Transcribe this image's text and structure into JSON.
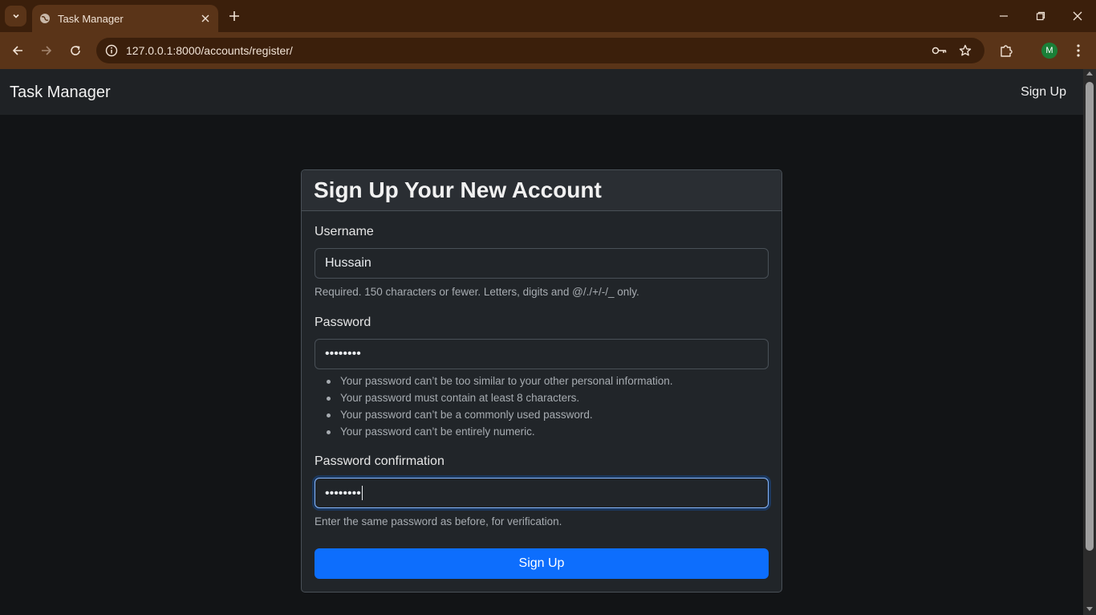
{
  "browser": {
    "tab_title": "Task Manager",
    "url": "127.0.0.1:8000/accounts/register/",
    "profile_initial": "M",
    "icons": {
      "tab_search": "chevron-down-icon",
      "favicon": "globe-icon",
      "tab_close": "close-icon",
      "new_tab": "plus-icon",
      "back": "arrow-left-icon",
      "forward": "arrow-right-icon",
      "reload": "reload-icon",
      "site_info": "info-icon",
      "password_key": "key-icon",
      "bookmark": "star-icon",
      "extensions": "puzzle-icon",
      "menu": "kebab-menu-icon",
      "minimize": "minimize-icon",
      "restore": "restore-icon",
      "close_window": "close-icon"
    }
  },
  "navbar": {
    "brand": "Task Manager",
    "signup_link": "Sign Up"
  },
  "form": {
    "title": "Sign Up Your New Account",
    "username": {
      "label": "Username",
      "value": "Hussain",
      "help": "Required. 150 characters or fewer. Letters, digits and @/./+/-/_ only."
    },
    "password": {
      "label": "Password",
      "value": "••••••••",
      "rules": [
        "Your password can’t be too similar to your other personal information.",
        "Your password must contain at least 8 characters.",
        "Your password can’t be a commonly used password.",
        "Your password can’t be entirely numeric."
      ]
    },
    "password_confirmation": {
      "label": "Password confirmation",
      "value": "••••••••",
      "help": "Enter the same password as before, for verification."
    },
    "submit_label": "Sign Up"
  },
  "colors": {
    "tabbar": "#3b1f0b",
    "toolbar": "#5a3418",
    "page_bg": "#121416",
    "card_bg": "#212529",
    "primary": "#0d6efd"
  }
}
